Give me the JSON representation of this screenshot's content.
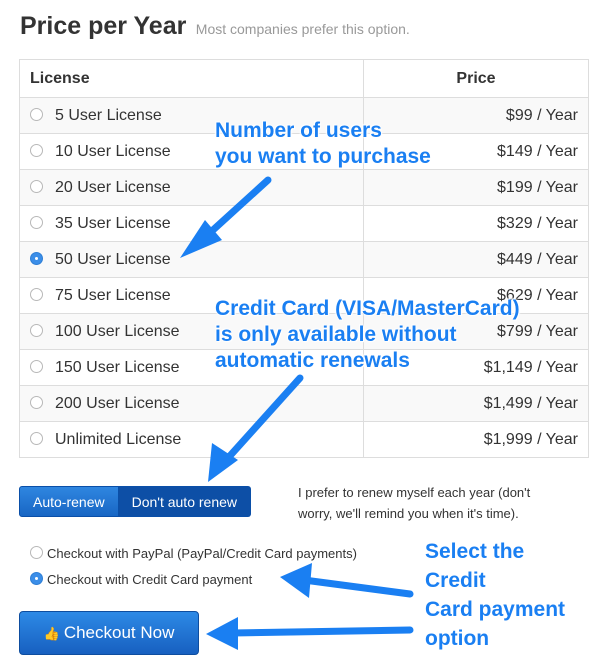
{
  "header": {
    "title": "Price per Year",
    "subtitle": "Most companies prefer this option."
  },
  "table": {
    "columns": [
      "License",
      "Price"
    ],
    "rows": [
      {
        "license": "5 User License",
        "price": "$99 / Year",
        "selected": false
      },
      {
        "license": "10 User License",
        "price": "$149 / Year",
        "selected": false
      },
      {
        "license": "20 User License",
        "price": "$199 / Year",
        "selected": false
      },
      {
        "license": "35 User License",
        "price": "$329 / Year",
        "selected": false
      },
      {
        "license": "50 User License",
        "price": "$449 / Year",
        "selected": true
      },
      {
        "license": "75 User License",
        "price": "$629 / Year",
        "selected": false
      },
      {
        "license": "100 User License",
        "price": "$799 / Year",
        "selected": false
      },
      {
        "license": "150 User License",
        "price": "$1,149 / Year",
        "selected": false
      },
      {
        "license": "200 User License",
        "price": "$1,499 / Year",
        "selected": false
      },
      {
        "license": "Unlimited License",
        "price": "$1,999 / Year",
        "selected": false
      }
    ]
  },
  "renewal": {
    "auto_label": "Auto-renew",
    "no_auto_label": "Don't auto renew",
    "selected": "Don't auto renew",
    "note": "I prefer to renew myself each year (don't worry, we'll remind you when it's time)."
  },
  "payment": {
    "paypal_label": "Checkout with PayPal (PayPal/Credit Card payments)",
    "card_label": "Checkout with Credit Card payment",
    "selected": "card"
  },
  "checkout": {
    "label": "Checkout Now",
    "icon": "thumbs-up-icon"
  },
  "annotations": {
    "users": "Number of users\nyou want to purchase",
    "credit": "Credit Card (VISA/MasterCard)\nis only available without\nautomatic renewals",
    "select": "Select the\nCredit\nCard payment\noption"
  },
  "colors": {
    "accent": "#1a7ff2",
    "button": "#1866c4",
    "button_dark": "#0d4fa6"
  }
}
